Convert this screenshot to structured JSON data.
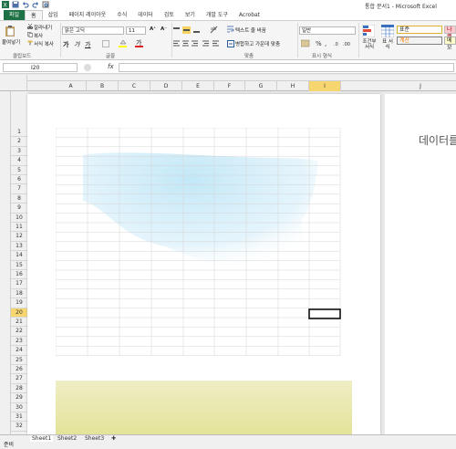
{
  "window": {
    "title": "통합 문서1 - Microsoft Excel"
  },
  "ribbon_tabs": [
    "파일",
    "홈",
    "삽입",
    "페이지 레이아웃",
    "수식",
    "데이터",
    "검토",
    "보기",
    "개발 도구",
    "Acrobat"
  ],
  "clipboard": {
    "paste": "붙여넣기",
    "cut": "잘라내기",
    "copy": "복사",
    "format_painter": "서식 복사",
    "group": "클립보드"
  },
  "font": {
    "name": "맑은 고딕",
    "size": "11",
    "group": "글꼴"
  },
  "alignment": {
    "wrap": "텍스트 줄 바꿈",
    "merge": "병합하고 가운데 맞춤",
    "group": "맞춤"
  },
  "number": {
    "format": "일반",
    "group": "표시 형식"
  },
  "styles": {
    "conditional": "조건부 서식",
    "table": "표 서식",
    "normal": "표준",
    "bad": "나쁨",
    "calc": "계산",
    "explain": "메모"
  },
  "formula_bar": {
    "name_box": "I20",
    "fx": "fx"
  },
  "columns": [
    "A",
    "B",
    "C",
    "D",
    "E",
    "F",
    "G",
    "H",
    "I",
    "J"
  ],
  "rows": [
    "1",
    "2",
    "3",
    "4",
    "5",
    "6",
    "7",
    "8",
    "9",
    "10",
    "11",
    "12",
    "13",
    "14",
    "15",
    "16",
    "17",
    "18",
    "19",
    "20",
    "21",
    "22",
    "23",
    "24",
    "25",
    "26",
    "27",
    "28",
    "29",
    "30",
    "31",
    "32"
  ],
  "selected_cell": "I20",
  "page2_text": "데이터를",
  "sheets": [
    "Sheet1",
    "Sheet2",
    "Sheet3"
  ],
  "status": "준비",
  "colors": {
    "excel_green": "#1e7145",
    "selection": "#f8d66f",
    "sky": "#bfe6f7",
    "grass": "#e8e6a5"
  }
}
